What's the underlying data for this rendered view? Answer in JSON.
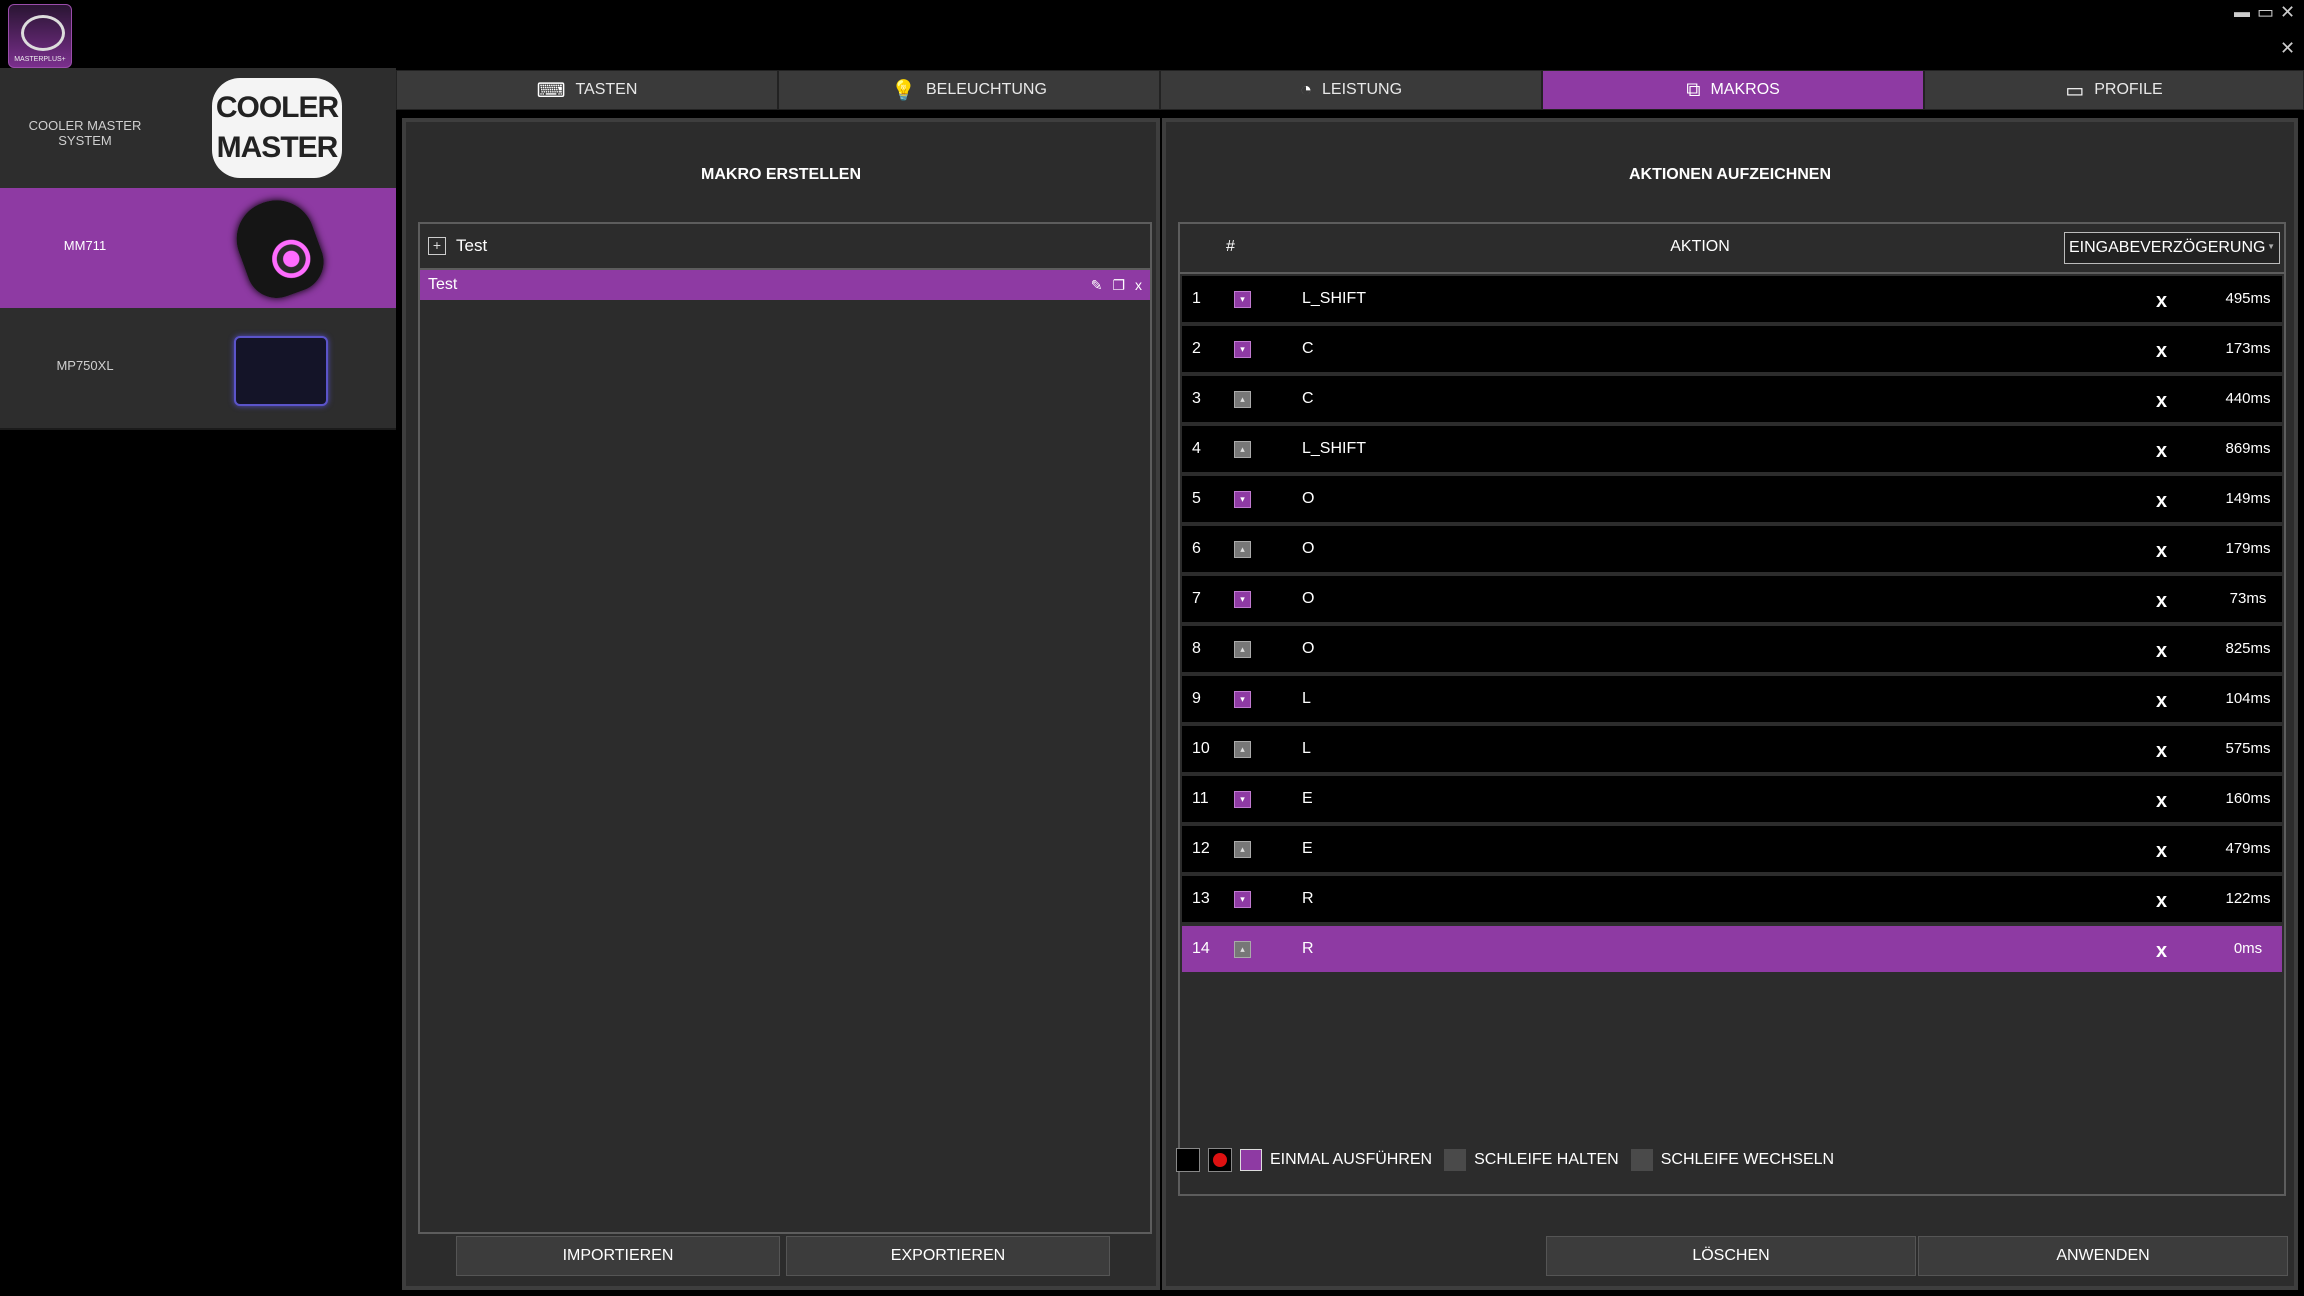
{
  "app": {
    "logo_text": "MASTERPLUS+",
    "minimize": "▬",
    "maximize": "▭",
    "close": "✕"
  },
  "devices": [
    {
      "name": "COOLER MASTER SYSTEM",
      "logo_text": "COOLER MASTER",
      "active": false
    },
    {
      "name": "MM711",
      "active": true
    },
    {
      "name": "MP750XL",
      "active": false
    }
  ],
  "tabs": [
    {
      "label": "TASTEN",
      "icon": "keyboard-icon"
    },
    {
      "label": "BELEUCHTUNG",
      "icon": "bulb-icon"
    },
    {
      "label": "LEISTUNG",
      "icon": "gauge-icon"
    },
    {
      "label": "MAKROS",
      "icon": "macro-icon",
      "active": true
    },
    {
      "label": "PROFILE",
      "icon": "profile-icon"
    }
  ],
  "macro_panel": {
    "title": "MAKRO ERSTELLEN",
    "group_name": "Test",
    "selected_macro": "Test",
    "import_label": "IMPORTIEREN",
    "export_label": "EXPORTIEREN"
  },
  "actions_panel": {
    "title": "AKTIONEN AUFZEICHNEN",
    "col_num": "#",
    "col_action": "AKTION",
    "delay_option": "EINGABEVERZÖGERUNG",
    "rows": [
      {
        "n": "1",
        "state": "down",
        "key": "L_SHIFT",
        "ms": "495ms"
      },
      {
        "n": "2",
        "state": "down",
        "key": "C",
        "ms": "173ms"
      },
      {
        "n": "3",
        "state": "up",
        "key": "C",
        "ms": "440ms"
      },
      {
        "n": "4",
        "state": "up",
        "key": "L_SHIFT",
        "ms": "869ms"
      },
      {
        "n": "5",
        "state": "down",
        "key": "O",
        "ms": "149ms"
      },
      {
        "n": "6",
        "state": "up",
        "key": "O",
        "ms": "179ms"
      },
      {
        "n": "7",
        "state": "down",
        "key": "O",
        "ms": "73ms"
      },
      {
        "n": "8",
        "state": "up",
        "key": "O",
        "ms": "825ms"
      },
      {
        "n": "9",
        "state": "down",
        "key": "L",
        "ms": "104ms"
      },
      {
        "n": "10",
        "state": "up",
        "key": "L",
        "ms": "575ms"
      },
      {
        "n": "11",
        "state": "down",
        "key": "E",
        "ms": "160ms"
      },
      {
        "n": "12",
        "state": "up",
        "key": "E",
        "ms": "479ms"
      },
      {
        "n": "13",
        "state": "down",
        "key": "R",
        "ms": "122ms"
      },
      {
        "n": "14",
        "state": "up",
        "key": "R",
        "ms": "0ms",
        "selected": true
      }
    ],
    "delete_glyph": "x",
    "run_once": "EINMAL AUSFÜHREN",
    "loop_hold": "SCHLEIFE HALTEN",
    "loop_toggle": "SCHLEIFE WECHSELN",
    "selected_run_mode": "EINMAL AUSFÜHREN",
    "delete_label": "LÖSCHEN",
    "apply_label": "ANWENDEN"
  },
  "colors": {
    "accent": "#8e3aa3",
    "panel": "#2c2c2c",
    "row": "#000000"
  }
}
